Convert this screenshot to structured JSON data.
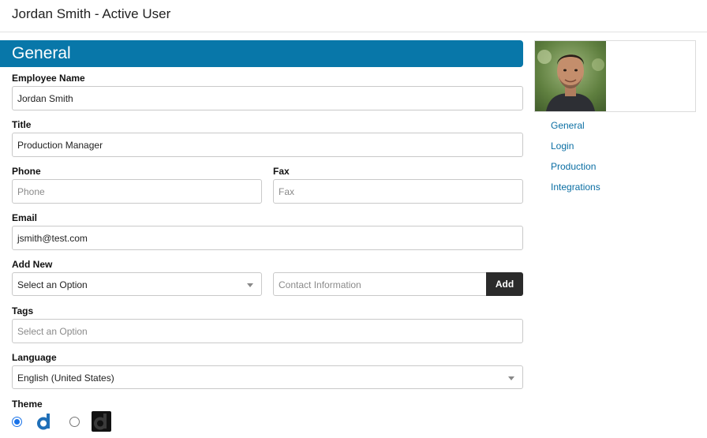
{
  "header": {
    "title": "Jordan Smith - Active User"
  },
  "section": {
    "title": "General"
  },
  "form": {
    "employee_name": {
      "label": "Employee Name",
      "value": "Jordan Smith"
    },
    "title": {
      "label": "Title",
      "value": "Production Manager"
    },
    "phone": {
      "label": "Phone",
      "placeholder": "Phone"
    },
    "fax": {
      "label": "Fax",
      "placeholder": "Fax"
    },
    "email": {
      "label": "Email",
      "value": "jsmith@test.com"
    },
    "add_new": {
      "label": "Add New",
      "select_value": "Select an Option",
      "contact_placeholder": "Contact Information",
      "button": "Add"
    },
    "tags": {
      "label": "Tags",
      "placeholder": "Select an Option"
    },
    "language": {
      "label": "Language",
      "value": "English (United States)"
    },
    "theme": {
      "label": "Theme",
      "options": [
        "light",
        "dark"
      ],
      "selected": "light"
    }
  },
  "sidebar": {
    "links": [
      {
        "label": "General"
      },
      {
        "label": "Login"
      },
      {
        "label": "Production"
      },
      {
        "label": "Integrations"
      }
    ]
  },
  "colors": {
    "accent": "#0877a9",
    "link": "#0a6ea3",
    "button": "#2b2b2b"
  }
}
